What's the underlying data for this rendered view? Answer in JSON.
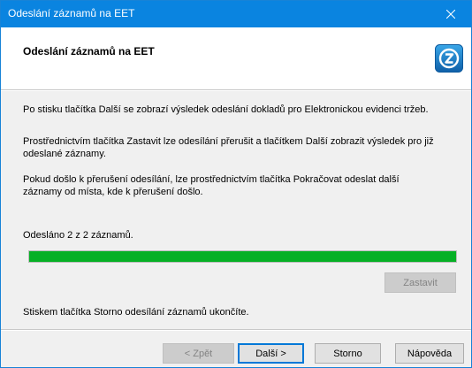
{
  "window": {
    "title": "Odeslání záznamů na EET"
  },
  "header": {
    "title": "Odeslání záznamů na EET",
    "logo_icon": "eet-logo-icon"
  },
  "body": {
    "paragraph1": "Po stisku tlačítka Další se zobrazí výsledek odeslání dokladů pro Elektronickou evidenci tržeb.",
    "paragraph2_line1": "Prostřednictvím tlačítka Zastavit lze odesílání přerušit a tlačítkem Další zobrazit výsledek pro již",
    "paragraph2_line2": "odeslané záznamy.",
    "paragraph3_line1": "Pokud došlo k přerušení odesílání, lze prostřednictvím tlačítka Pokračovat odeslat další",
    "paragraph3_line2": "záznamy od místa, kde k přerušení došlo.",
    "status": "Odesláno 2 z 2 záznamů.",
    "progress_fraction": 1.0,
    "stop_label": "Zastavit",
    "hint": "Stiskem tlačítka Storno odesílání záznamů ukončíte."
  },
  "footer": {
    "back_label": "< Zpět",
    "next_label": "Další >",
    "cancel_label": "Storno",
    "help_label": "Nápověda"
  },
  "colors": {
    "titlebar": "#0a84e0",
    "progress": "#06b025"
  }
}
